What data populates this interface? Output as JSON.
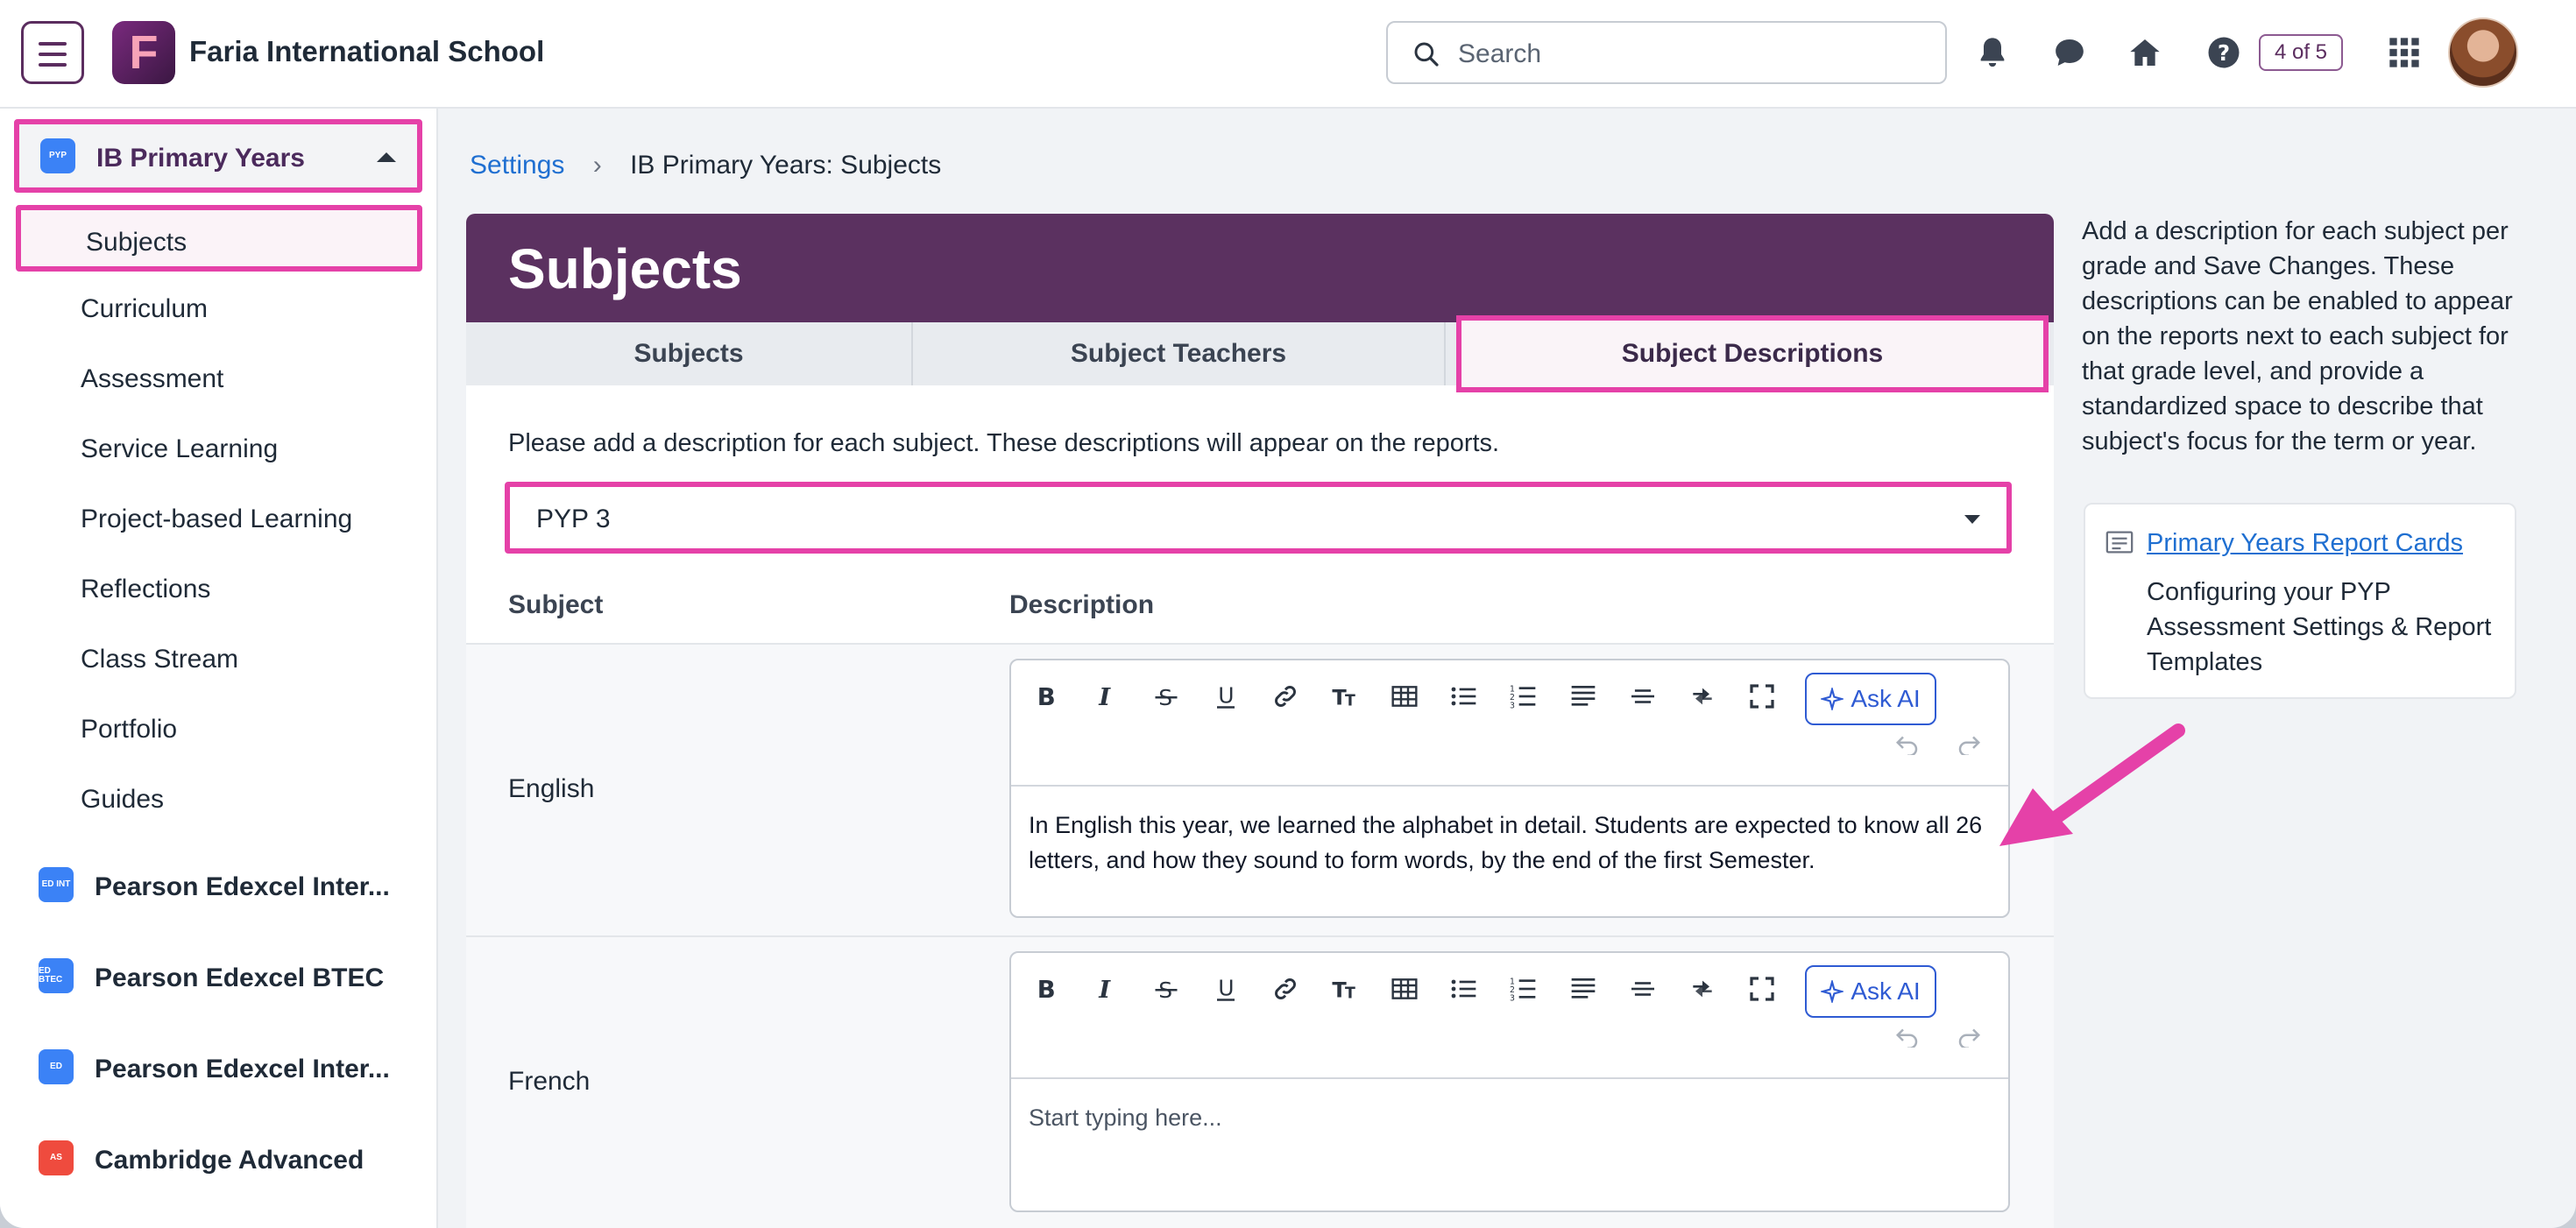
{
  "topbar": {
    "school_name": "Faria International School",
    "logo_letter": "F",
    "search_placeholder": "Search",
    "pager": "4 of 5",
    "icons": [
      "menu-icon",
      "bell-icon",
      "chat-icon",
      "home-icon",
      "help-icon",
      "apps-grid-icon",
      "avatar"
    ]
  },
  "sidebar": {
    "program": {
      "badge": "PYP",
      "title": "IB Primary Years"
    },
    "active_item": "Subjects",
    "items": [
      "Curriculum",
      "Assessment",
      "Service Learning",
      "Project-based Learning",
      "Reflections",
      "Class Stream",
      "Portfolio",
      "Guides"
    ],
    "programs": [
      {
        "badge": "ED INT",
        "label": "Pearson Edexcel Inter..."
      },
      {
        "badge": "ED BTEC",
        "label": "Pearson Edexcel BTEC"
      },
      {
        "badge": "ED",
        "label": "Pearson Edexcel Inter..."
      },
      {
        "badge": "AS",
        "label": "Cambridge Advanced"
      }
    ]
  },
  "breadcrumb": {
    "parent": "Settings",
    "current": "IB Primary Years: Subjects"
  },
  "page": {
    "title": "Subjects",
    "tabs": [
      "Subjects",
      "Subject Teachers",
      "Subject Descriptions"
    ],
    "active_tab": "Subject Descriptions",
    "intro": "Please add a description for each subject. These descriptions will appear on the reports.",
    "grade_selected": "PYP 3",
    "columns": {
      "subject": "Subject",
      "description": "Description"
    },
    "ask_ai_label": "Ask AI",
    "rows": [
      {
        "subject": "English",
        "text": "In English this year, we learned the alphabet in detail. Students are expected to know all 26 letters, and how they sound to form words, by the end of the first Semester."
      },
      {
        "subject": "French",
        "text": "Start typing here..."
      }
    ]
  },
  "help": {
    "text": "Add a description for each subject per grade and Save Changes. These descriptions can be enabled to appear on the reports next to each subject for that grade level, and provide a standardized space to describe that subject's focus for the term or year.",
    "link": "Primary Years Report Cards",
    "desc": "Configuring your PYP Assessment Settings & Report Templates"
  },
  "colors": {
    "brand": "#5b3160",
    "highlight": "#e541a8",
    "link": "#1f6fd1"
  }
}
